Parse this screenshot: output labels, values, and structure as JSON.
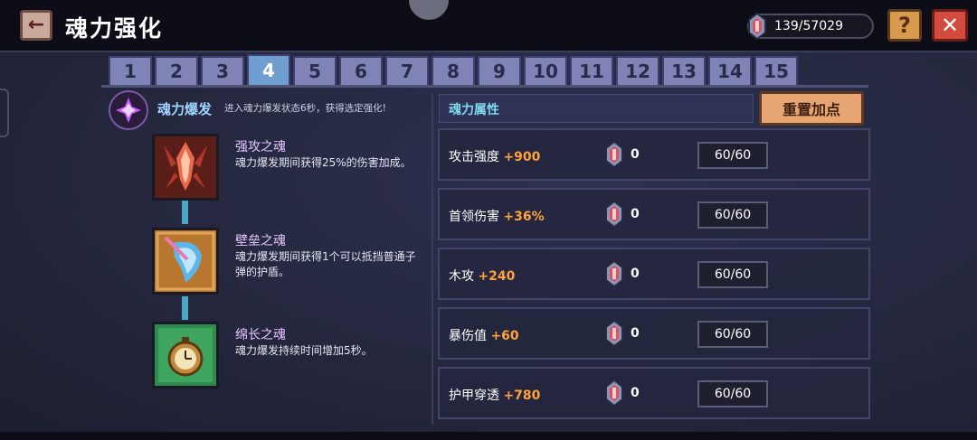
{
  "header": {
    "title": "魂力强化",
    "back_icon": "←",
    "currency": "139/57029",
    "help_label": "?",
    "close_label": "✕"
  },
  "tabs": [
    "1",
    "2",
    "3",
    "4",
    "5",
    "6",
    "7",
    "8",
    "9",
    "10",
    "11",
    "12",
    "13",
    "14",
    "15"
  ],
  "active_tab": "4",
  "burst": {
    "title": "魂力爆发",
    "description": "进入魂力爆发状态6秒，获得选定强化!"
  },
  "skills": [
    {
      "name": "强攻之魂",
      "description": "魂力爆发期间获得25%的伤害加成。"
    },
    {
      "name": "壁垒之魂",
      "description": "魂力爆发期间获得1个可以抵挡普通子弹的护盾。"
    },
    {
      "name": "绵长之魂",
      "description": "魂力爆发持续时间增加5秒。"
    }
  ],
  "attributes": {
    "header": "魂力属性",
    "reset_label": "重置加点",
    "rows": [
      {
        "name": "攻击强度",
        "bonus": "+900",
        "count": "0",
        "level": "60/60"
      },
      {
        "name": "首领伤害",
        "bonus": "+36%",
        "count": "0",
        "level": "60/60"
      },
      {
        "name": "木攻",
        "bonus": "+240",
        "count": "0",
        "level": "60/60"
      },
      {
        "name": "暴伤值",
        "bonus": "+60",
        "count": "0",
        "level": "60/60"
      },
      {
        "name": "护甲穿透",
        "bonus": "+780",
        "count": "0",
        "level": "60/60"
      }
    ]
  },
  "colors": {
    "bonus": "#ffa23a",
    "tab_active": "#6f9fd0",
    "tab_inactive": "#7f83b6",
    "skill_name": "#e6c8ff"
  }
}
